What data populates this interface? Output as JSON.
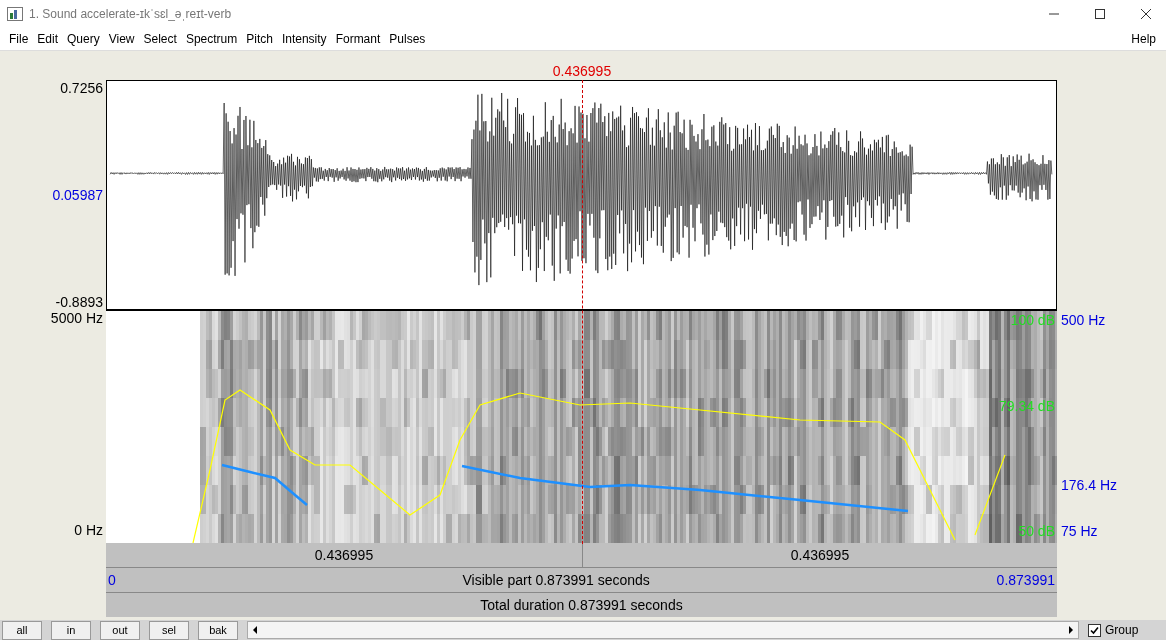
{
  "window": {
    "title": "1. Sound accelerate-ɪkˈsɛl_əˌreɪt-verb"
  },
  "menu": [
    "File",
    "Edit",
    "Query",
    "View",
    "Select",
    "Spectrum",
    "Pitch",
    "Intensity",
    "Formant",
    "Pulses"
  ],
  "help": "Help",
  "cursor": {
    "time": "0.436995"
  },
  "waveform": {
    "max": "0.7256",
    "center": "0.05987",
    "min": "-0.8893"
  },
  "spectrogram": {
    "top": "5000 Hz",
    "bottom": "0 Hz",
    "pitch_labels": [
      "500 Hz",
      "176.4 Hz",
      "75 Hz"
    ],
    "intensity_labels": [
      "100 dB",
      "79.34 dB",
      "50 dB"
    ]
  },
  "time_row": [
    "0.436995",
    "0.436995"
  ],
  "visible": {
    "start": "0",
    "label": "Visible part 0.873991 seconds",
    "end": "0.873991"
  },
  "total": "Total duration 0.873991 seconds",
  "buttons": [
    "all",
    "in",
    "out",
    "sel",
    "bak"
  ],
  "group": {
    "label": "Group",
    "checked": true
  }
}
